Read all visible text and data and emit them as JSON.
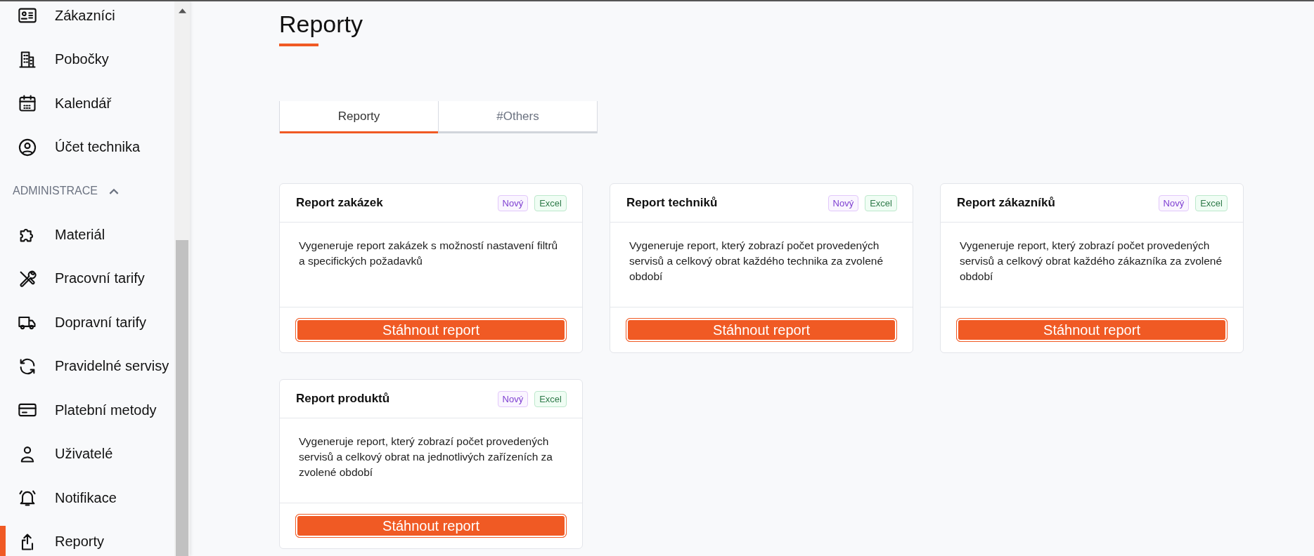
{
  "sidebar": {
    "items_top": [
      {
        "label": "Zákazníci",
        "selected": false
      },
      {
        "label": "Pobočky",
        "selected": false
      },
      {
        "label": "Kalendář",
        "selected": false
      },
      {
        "label": "Účet technika",
        "selected": false
      }
    ],
    "section": {
      "label": "ADMINISTRACE",
      "expanded": true,
      "items": [
        {
          "label": "Materiál",
          "selected": false
        },
        {
          "label": "Pracovní tarify",
          "selected": false
        },
        {
          "label": "Dopravní tarify",
          "selected": false
        },
        {
          "label": "Pravidelné servisy",
          "selected": false
        },
        {
          "label": "Platební metody",
          "selected": false
        },
        {
          "label": "Uživatelé",
          "selected": false
        },
        {
          "label": "Notifikace",
          "selected": false
        },
        {
          "label": "Reporty",
          "selected": true
        }
      ]
    }
  },
  "page": {
    "title": "Reporty"
  },
  "tabs": [
    {
      "label": "Reporty",
      "selected": true
    },
    {
      "label": "#Others",
      "selected": false
    }
  ],
  "cards": [
    {
      "title": "Report zakázek",
      "badges": [
        {
          "label": "Nový",
          "kind": "new"
        },
        {
          "label": "Excel",
          "kind": "excel"
        }
      ],
      "description": "Vygeneruje report zakázek s možností nastavení filtrů a specifických požadavků",
      "button": "Stáhnout report"
    },
    {
      "title": "Report techniků",
      "badges": [
        {
          "label": "Nový",
          "kind": "new"
        },
        {
          "label": "Excel",
          "kind": "excel"
        }
      ],
      "description": "Vygeneruje report, který zobrazí počet provedených servisů a celkový obrat každého technika za zvolené období",
      "button": "Stáhnout report"
    },
    {
      "title": "Report zákazníků",
      "badges": [
        {
          "label": "Nový",
          "kind": "new"
        },
        {
          "label": "Excel",
          "kind": "excel"
        }
      ],
      "description": "Vygeneruje report, který zobrazí počet provedených servisů a celkový obrat každého zákazníka za zvolené období",
      "button": "Stáhnout report"
    },
    {
      "title": "Report produktů",
      "badges": [
        {
          "label": "Nový",
          "kind": "new"
        },
        {
          "label": "Excel",
          "kind": "excel"
        }
      ],
      "description": "Vygeneruje report, který zobrazí počet provedených servisů a celkový obrat na jednotlivých zařízeních za zvolené období",
      "button": "Stáhnout report"
    }
  ]
}
